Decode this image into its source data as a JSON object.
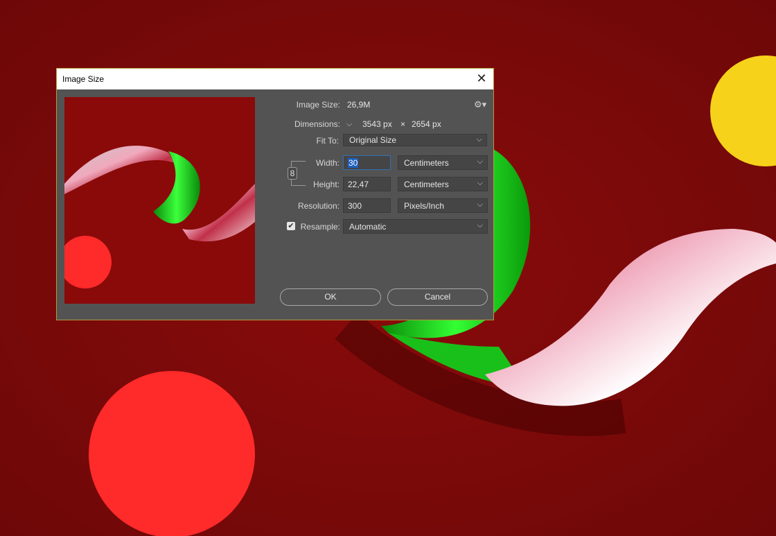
{
  "dialog": {
    "title": "Image Size",
    "image_size_label": "Image Size:",
    "image_size_value": "26,9M",
    "dimensions_label": "Dimensions:",
    "dim_width": "3543 px",
    "dim_times": "×",
    "dim_height": "2654 px",
    "fit_to_label": "Fit To:",
    "fit_to_value": "Original Size",
    "width_label": "Width:",
    "width_value": "30",
    "width_unit": "Centimeters",
    "height_label": "Height:",
    "height_value": "22,47",
    "height_unit": "Centimeters",
    "resolution_label": "Resolution:",
    "resolution_value": "300",
    "resolution_unit": "Pixels/Inch",
    "resample_label": "Resample:",
    "resample_checked": true,
    "resample_value": "Automatic",
    "ok_label": "OK",
    "cancel_label": "Cancel"
  },
  "icons": {
    "close": "close-icon",
    "settings": "gear-icon",
    "dimensions_toggle": "chevron-down-icon",
    "constrain": "link-icon",
    "dropdown": "chevron-down-icon",
    "checkmark": "checkmark-icon"
  },
  "colors": {
    "canvas_background": "#7d0a0a",
    "dialog_background": "#535353",
    "ribbon_green": "#1fcf1f",
    "ribbon_pink": "#e8a0b4",
    "dot_red": "#ff2a2a",
    "dot_yellow": "#f6d21a"
  }
}
